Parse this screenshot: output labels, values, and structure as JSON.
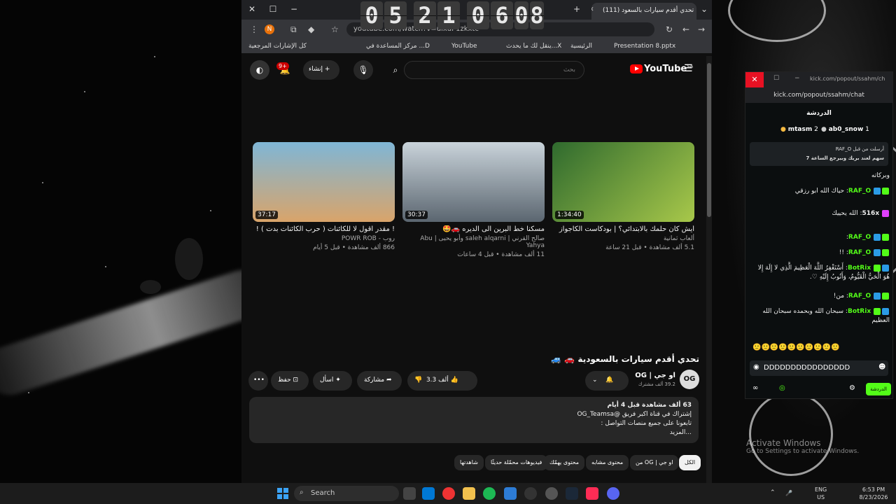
{
  "clock": {
    "digits": [
      "0",
      "5",
      "2",
      "1",
      "0",
      "6",
      "0",
      "8"
    ]
  },
  "browser": {
    "tab_title": "(111) تحدي أقدم سيارات بالسعود",
    "url": "youtube.com/watch?v=ulxuP1zkxtc",
    "profile_initial": "N",
    "bookmarks": [
      "كل الإشارات المرجعية",
      "مركز المساعدة في ...D",
      "YouTube",
      "ينقل لك ما يحدث...X",
      "الرئيسية",
      "Presentation 8.pptx"
    ]
  },
  "youtube": {
    "logo": "YouTube",
    "region": "SA",
    "search_placeholder": "بحث",
    "create_label": "إنشاء",
    "notif_count": "9+",
    "videos": [
      {
        "duration": "1:34:40",
        "title": "أيش كان حلمك بالابتدائي؟ | بودكاست الكاجواز",
        "channel": "ألعاب ثمانية",
        "meta": "5.1 ألف مشاهدة • قبل 21 ساعة",
        "color": "#3c8d3a"
      },
      {
        "duration": "30:37",
        "title": "مسكنا خط البرين الى الديره 🚗🤩",
        "channel": "صالح القرني | saleh alqarni وأبو يحيى | Abu Yahya",
        "meta": "11 ألف مشاهدة • قبل 4 ساعات",
        "color": "#7d8a93"
      },
      {
        "duration": "37:17",
        "title": "! مقدر اقول لا للكائنات ( حرب الكائنات بدت ) !",
        "channel": "روب - POWR ROB",
        "meta": "866 ألف مشاهدة • قبل 5 أيام",
        "color": "#7fb6d6"
      }
    ],
    "video_title": "تحدي أقدم سيارات بالسعودية 🚗 🚙",
    "channel_name": "او جي | OG",
    "channel_subs": "39.2 ألف مشترك",
    "channel_avatar": "OG",
    "likes": "3.3 ألف",
    "share_label": "مشاركة",
    "ask_label": "اسأل",
    "save_label": "حفظ",
    "description": {
      "line1": "63 ألف مشاهدة  قبل 4 أيام",
      "line2": "إشتراك في قناة اكبر فريق  @OG_Teamsa",
      "line3": "تابعونا على جميع منصات التواصل :",
      "more": "...المزيد"
    },
    "chips": [
      "الكل",
      "من OG | او جي",
      "محتوى مشابه",
      "محتوى يهمّك",
      "فيديوهات محمّلة حديثًا",
      "شاهدتها"
    ]
  },
  "kick": {
    "title_url": "kick.com/popout/ssahm/ch",
    "url": "kick.com/popout/ssahm/chat",
    "header": "الدردشة",
    "top_users": [
      {
        "name": "mtasm",
        "count": "2"
      },
      {
        "name": "ab0_snow",
        "count": "1"
      }
    ],
    "pinned": {
      "line1": "أرسلت من قبل RAF_O",
      "line2": "سهم لعند بريك وبيرجع الساعة 7"
    },
    "messages": [
      {
        "user": "",
        "text": "وبركاته"
      },
      {
        "user": "RAF_O",
        "text": "حياك الله ابو رزقي"
      },
      {
        "user": "516x",
        "text": "الله يحييك"
      },
      {
        "user": "RAF_O",
        "text": ""
      },
      {
        "user": "RAF_O",
        "text": "!!"
      },
      {
        "user": "BotRix",
        "text": "أَسْتَغْفِرُ اللَّهَ الْعَظِيمَ الَّذِي لا إِلَهَ إِلا هُوَ الْحَيُّ الْقَيُّومُ، وَأَتُوبُ إِلَيْهِ ♡."
      },
      {
        "user": "RAF_O",
        "text": "من!"
      },
      {
        "user": "BotRix",
        "text": "سبحان الله وبحمده سبحان الله العظيم"
      }
    ],
    "input_value": "DDDDDDDDDDDDDDDD",
    "chat_button": "الدردشة"
  },
  "taskbar": {
    "search": "Search",
    "lang": "ENG",
    "region": "US",
    "time": "6:53 PM",
    "date": "8/23/2026"
  },
  "watermark": {
    "title": "Activate Windows",
    "sub": "Go to Settings to activate Windows."
  }
}
